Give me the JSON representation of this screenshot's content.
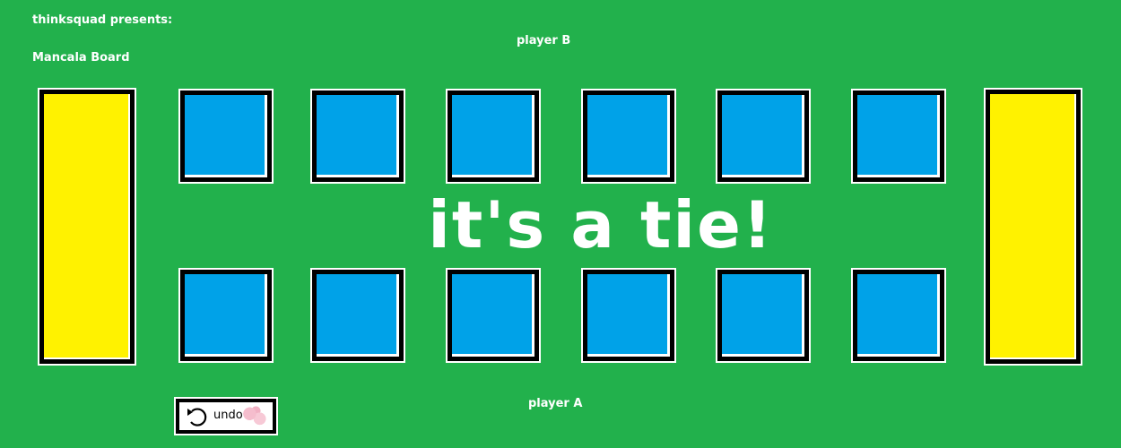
{
  "header": {
    "presents": "thinksquad presents:",
    "title": "Mancala Board"
  },
  "players": {
    "top_label": "player B",
    "bottom_label": "player A"
  },
  "result_message": "it's a tie!",
  "undo": {
    "label": "undo",
    "icon": "undo-arrow-icon"
  },
  "colors": {
    "background": "#22b14c",
    "store": "#fff200",
    "pit": "#00a2e8",
    "text": "#ffffff"
  }
}
